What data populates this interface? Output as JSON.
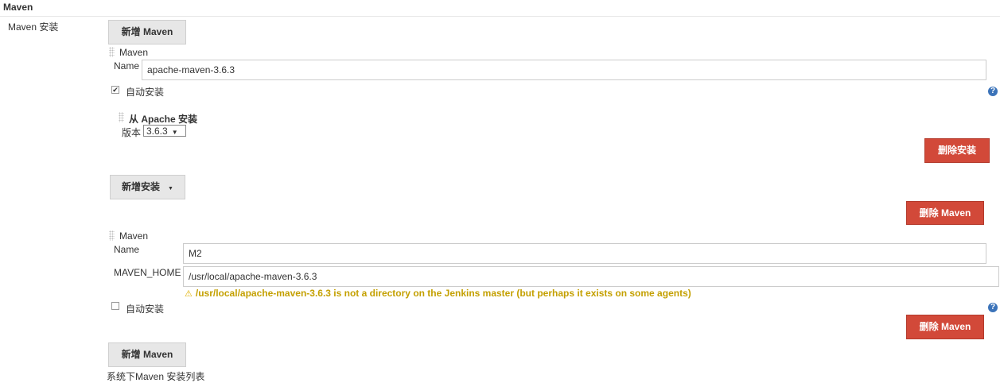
{
  "section": {
    "title": "Maven",
    "label": "Maven 安装"
  },
  "add_maven_label": "新增 Maven",
  "install1": {
    "header": "Maven",
    "name_label": "Name",
    "name_value": "apache-maven-3.6.3",
    "auto_install_label": "自动安装",
    "auto_install_checked": true,
    "installer": {
      "header": "从 Apache 安装",
      "version_label": "版本",
      "version_value": "3.6.3"
    },
    "delete_installer_label": "删除安装",
    "add_installer_label": "新增安装",
    "delete_maven_label": "删除 Maven"
  },
  "install2": {
    "header": "Maven",
    "name_label": "Name",
    "name_value": "M2",
    "home_label": "MAVEN_HOME",
    "home_value": "/usr/local/apache-maven-3.6.3",
    "warning": "/usr/local/apache-maven-3.6.3 is not a directory on the Jenkins master (but perhaps it exists on some agents)",
    "auto_install_label": "自动安装",
    "auto_install_checked": false,
    "delete_maven_label": "删除 Maven"
  },
  "footer_description": "系统下Maven 安装列表",
  "icons": {
    "help": "help-icon",
    "warning": "warning-icon",
    "drag": "drag-handle-icon"
  },
  "colors": {
    "delete_button": "#d24939",
    "warning_text": "#c4a000",
    "help_icon": "#3b73b9"
  }
}
